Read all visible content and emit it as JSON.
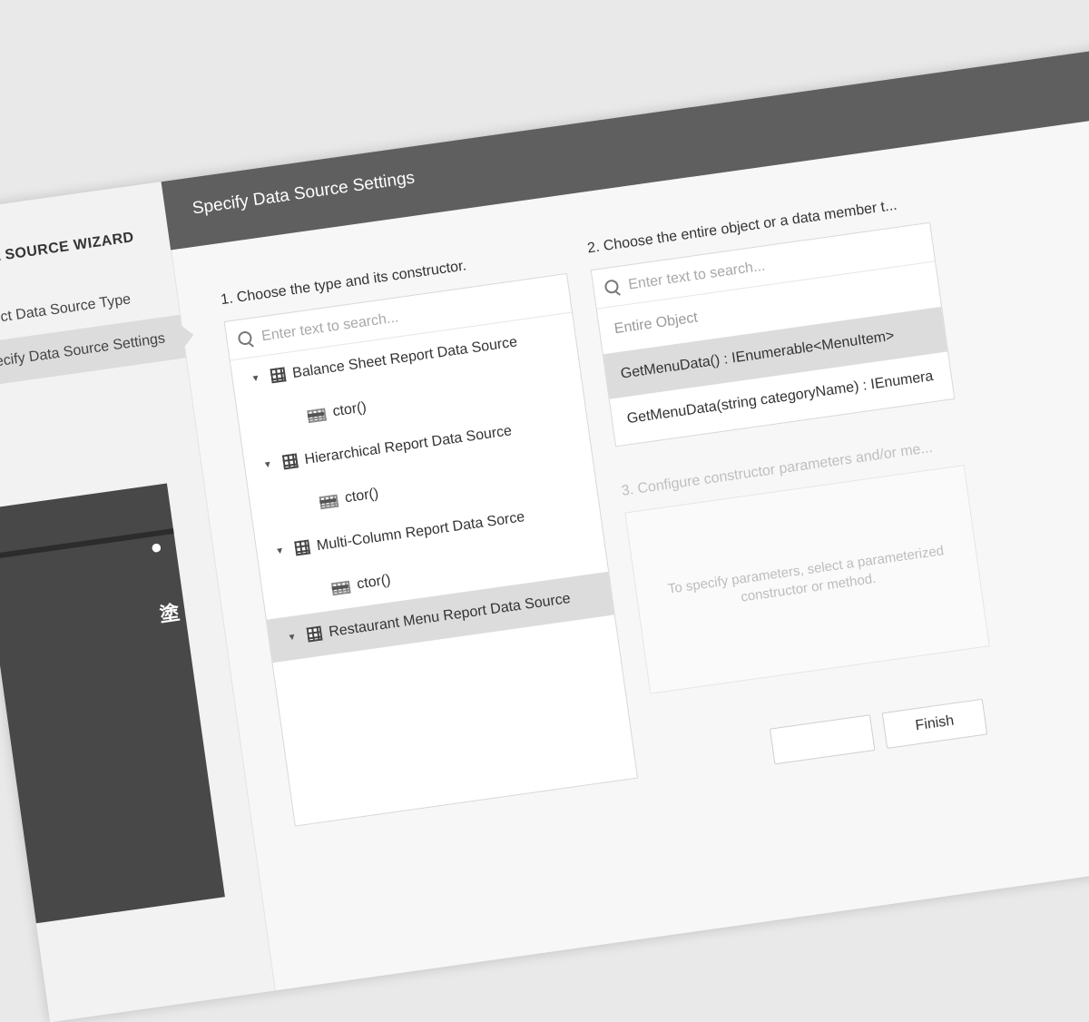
{
  "sidebar": {
    "title": "DATA SOURCE WIZARD",
    "items": [
      {
        "label": "Select Data Source Type"
      },
      {
        "label": "Specify Data Source Settings"
      }
    ]
  },
  "header": {
    "title": "Specify Data Source Settings"
  },
  "section1": {
    "label": "1. Choose the type and its constructor.",
    "search_placeholder": "Enter text to search...",
    "tree": [
      {
        "label": "Balance Sheet Report Data Source",
        "ctor": "ctor()"
      },
      {
        "label": "Hierarchical Report Data Source",
        "ctor": "ctor()"
      },
      {
        "label": "Multi-Column Report Data Sorce",
        "ctor": "ctor()"
      },
      {
        "label": "Restaurant Menu Report Data Source"
      }
    ]
  },
  "section2": {
    "label": "2. Choose the entire object or a data member t...",
    "search_placeholder": "Enter text to search...",
    "items": [
      {
        "label": "Entire Object"
      },
      {
        "label": "GetMenuData() : IEnumerable<MenuItem>"
      },
      {
        "label": "GetMenuData(string categoryName) : IEnumera"
      }
    ]
  },
  "section3": {
    "label": "3. Configure constructor parameters and/or me...",
    "hint": "To specify parameters, select a parameterized constructor or method."
  },
  "footer": {
    "finish_label": "Finish",
    "secondary_label": ""
  }
}
